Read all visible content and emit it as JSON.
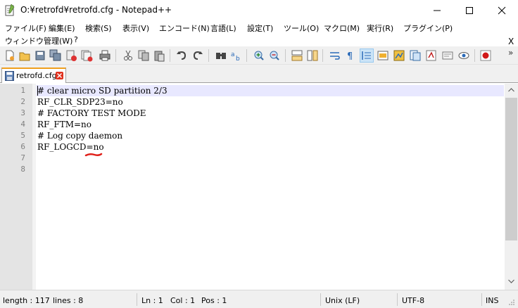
{
  "window": {
    "title": "O:¥retrofd¥retrofd.cfg - Notepad++",
    "minimize_icon": "minimize-icon",
    "maximize_icon": "maximize-icon",
    "close_icon": "close-icon"
  },
  "menubar": {
    "items": [
      "ファイル(F)",
      "編集(E)",
      "検索(S)",
      "表示(V)",
      "エンコード(N)",
      "言語(L)",
      "設定(T)",
      "ツール(O)",
      "マクロ(M)",
      "実行(R)",
      "プラグイン(P)"
    ],
    "row2": [
      "ウィンドウ管理(W)",
      "?"
    ],
    "close_doc": "X"
  },
  "toolbar": {
    "icons": [
      "new-file-icon",
      "open-file-icon",
      "save-icon",
      "save-all-icon",
      "close-icon",
      "close-all-icon",
      "print-icon",
      "cut-icon",
      "copy-icon",
      "paste-icon",
      "undo-icon",
      "redo-icon",
      "find-icon",
      "replace-icon",
      "zoom-in-icon",
      "zoom-out-icon",
      "sync-vertical-icon",
      "sync-horizontal-icon",
      "word-wrap-icon",
      "show-all-characters-icon",
      "indent-guide-icon",
      "user-language-icon",
      "document-map-icon",
      "function-list-icon",
      "folder-as-workspace-icon",
      "monitoring-icon",
      "record-macro-icon"
    ],
    "more": "»"
  },
  "tabs": [
    {
      "label": "retrofd.cfg",
      "icon": "saved-file-icon",
      "close_icon": "tab-close-icon"
    }
  ],
  "editor": {
    "line_numbers": [
      "1",
      "2",
      "3",
      "4",
      "5",
      "6",
      "7",
      "8"
    ],
    "lines": [
      "# clear micro SD partition 2/3",
      "RF_CLR_SDP23=no",
      "# FACTORY TEST MODE",
      "RF_FTM=no",
      "# Log copy daemon",
      "RF_LOGCD=no",
      "",
      ""
    ],
    "current_line_color": "#e8e8ff",
    "annotation_color": "#e0201a"
  },
  "statusbar": {
    "length": "length : 117",
    "lines": "lines : 8",
    "ln": "Ln : 1",
    "col": "Col : 1",
    "pos": "Pos : 1",
    "eol": "Unix (LF)",
    "encoding": "UTF-8",
    "mode": "INS"
  }
}
